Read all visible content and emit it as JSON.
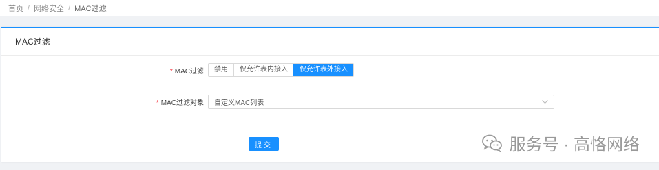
{
  "breadcrumb": {
    "items": [
      "首页",
      "网络安全",
      "MAC过滤"
    ],
    "separator": "/"
  },
  "card": {
    "title": "MAC过滤"
  },
  "form": {
    "mac_filter": {
      "required_mark": "*",
      "label": "MAC过滤",
      "options": [
        "禁用",
        "仅允许表内接入",
        "仅允许表外接入"
      ],
      "selected": "仅允许表外接入"
    },
    "mac_filter_target": {
      "required_mark": "*",
      "label": "MAC过滤对象",
      "value": "自定义MAC列表"
    },
    "submit_label": "提交"
  },
  "watermark": {
    "text": "服务号 · 高恪网络"
  },
  "colors": {
    "accent": "#1890ff",
    "required": "#f5222d"
  }
}
